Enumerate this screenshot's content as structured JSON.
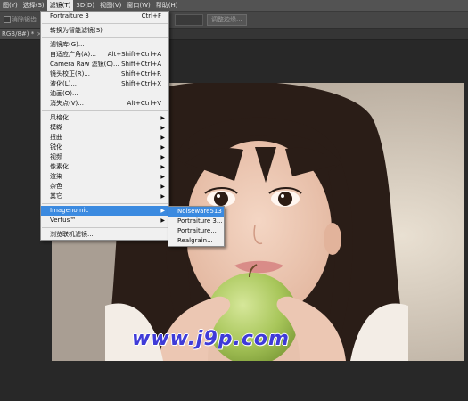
{
  "menubar": {
    "items": [
      "图(Y)",
      "选择(S)",
      "滤镜(T)",
      "3D(D)",
      "视图(V)",
      "窗口(W)",
      "帮助(H)"
    ],
    "active_index": 2
  },
  "options": {
    "label": "消除锯齿",
    "button": "调整边缘..."
  },
  "tab": {
    "title": "RGB/8#) *",
    "close": "×"
  },
  "filter_menu": {
    "last_filter": {
      "label": "Portraiture 3",
      "shortcut": "Ctrl+F"
    },
    "smart": "转换为智能滤镜(S)",
    "group1": [
      {
        "label": "滤镜库(G)...",
        "shortcut": ""
      },
      {
        "label": "自适应广角(A)...",
        "shortcut": "Alt+Shift+Ctrl+A"
      },
      {
        "label": "Camera Raw 滤镜(C)...",
        "shortcut": "Shift+Ctrl+A"
      },
      {
        "label": "镜头校正(R)...",
        "shortcut": "Shift+Ctrl+R"
      },
      {
        "label": "液化(L)...",
        "shortcut": "Shift+Ctrl+X"
      },
      {
        "label": "油画(O)...",
        "shortcut": ""
      },
      {
        "label": "消失点(V)...",
        "shortcut": "Alt+Ctrl+V"
      }
    ],
    "group2": [
      "风格化",
      "模糊",
      "扭曲",
      "锐化",
      "视频",
      "像素化",
      "渲染",
      "杂色",
      "其它"
    ],
    "group3": [
      "Imagenomic",
      "Vertus™"
    ],
    "browse": "浏览联机滤镜..."
  },
  "submenu": {
    "items": [
      "Noiseware513",
      "Portraiture 3...",
      "Portraiture...",
      "Realgrain..."
    ]
  },
  "watermark": "www.j9p.com",
  "colors": {
    "menubar_bg": "#535353",
    "menu_bg": "#f0f0f0",
    "highlight": "#3b8ae0",
    "watermark": "#3f3bd8"
  }
}
